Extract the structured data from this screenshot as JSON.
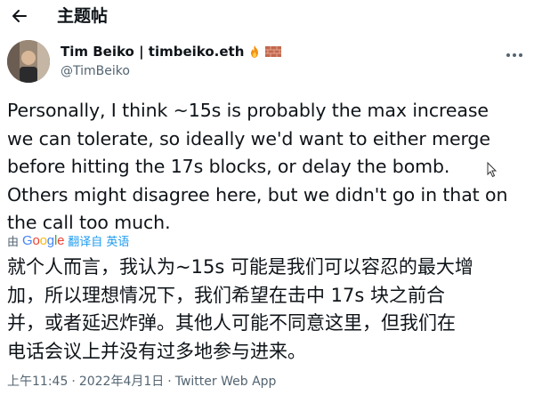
{
  "header": {
    "title": "主题帖"
  },
  "author": {
    "name": "Tim Beiko | timbeiko.eth",
    "handle": "@TimBeiko"
  },
  "tweet": {
    "lines": [
      "Personally, I think ~15s is probably the max increase",
      "we can tolerate, so ideally we'd want to either merge",
      "before hitting the 17s blocks, or delay the bomb.",
      "Others might disagree here, but we didn't go in that on",
      "the call too much."
    ]
  },
  "translation": {
    "by_label": "由",
    "provider": "Google",
    "link_label": "翻译自 英语",
    "lines": [
      "就个人而言，我认为~15s 可能是我们可以容忍的最大增",
      "加，所以理想情况下，我们希望在击中 17s 块之前合",
      "并，或者延迟炸弹。其他人可能不同意这里，但我们在",
      "电话会议上并没有过多地参与进来。"
    ]
  },
  "meta": {
    "time": "上午11:45",
    "separator": "·",
    "date": "2022年4月1日",
    "separator2": "·",
    "source": "Twitter Web App"
  },
  "icons": {
    "back": "arrow-left-icon",
    "more": "more-horizontal-icon",
    "badge_fire": "fire-emoji-icon",
    "badge_brick": "brick-emoji-icon",
    "cursor": "mouse-cursor-icon"
  },
  "colors": {
    "text": "#0f1419",
    "secondary": "#536471",
    "link": "#1d9bf0"
  }
}
